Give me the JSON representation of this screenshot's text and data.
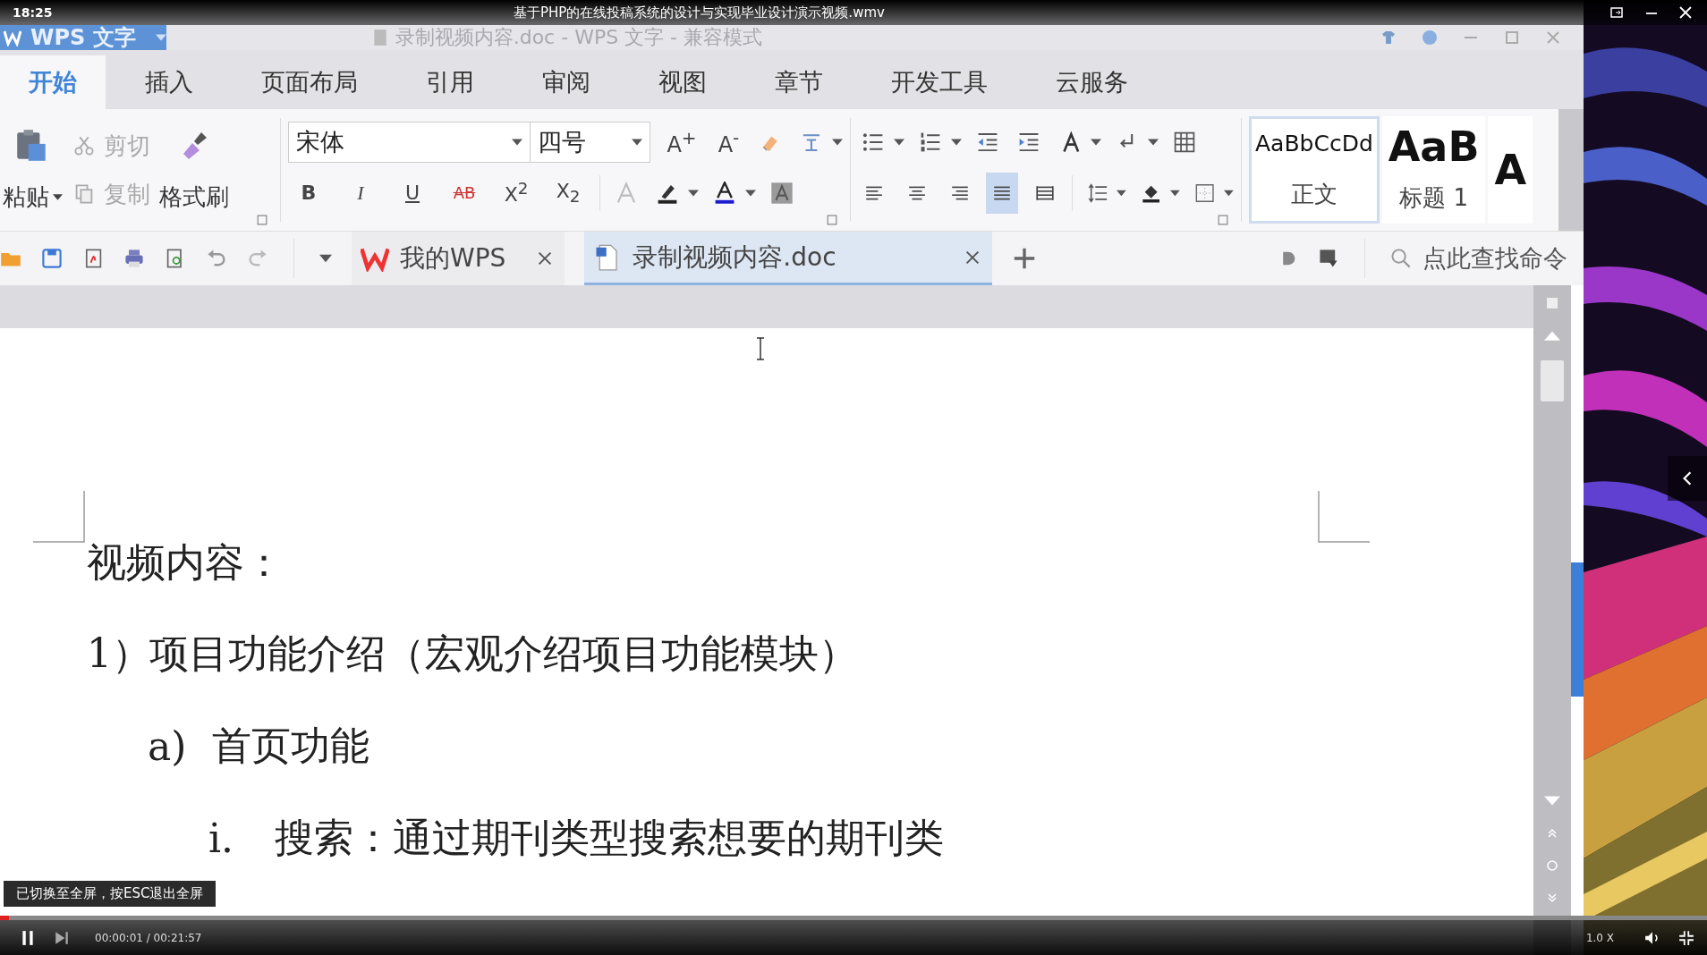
{
  "player": {
    "clock": "18:25",
    "title": "基于PHP的在线投稿系统的设计与实现毕业设计演示视频.wmv",
    "playing": true,
    "progress": {
      "level": 0.005
    },
    "time": "00:00:01 / 00:21:57",
    "speed": "1.0 X",
    "toast": "已切换至全屏，按ESC退出全屏"
  },
  "wps": {
    "app_button": "WPS 文字",
    "window_title": "录制视频内容.doc - WPS 文字 - 兼容模式",
    "tabs": [
      {
        "label": "开始",
        "selected": true
      },
      {
        "label": "插入",
        "selected": false
      },
      {
        "label": "页面布局",
        "selected": false
      },
      {
        "label": "引用",
        "selected": false
      },
      {
        "label": "审阅",
        "selected": false
      },
      {
        "label": "视图",
        "selected": false
      },
      {
        "label": "章节",
        "selected": false
      },
      {
        "label": "开发工具",
        "selected": false
      },
      {
        "label": "云服务",
        "selected": false
      }
    ],
    "clipboard": {
      "paste": "粘贴",
      "cut": "剪切",
      "copy": "复制",
      "format_painter": "格式刷"
    },
    "font": {
      "value": "宋体"
    },
    "font_size": {
      "value": "四号"
    },
    "size_buttons": [
      "A$^{+}$",
      "A$^{-}$"
    ],
    "format_buttons": [
      "B",
      "I",
      "U",
      "AB",
      "X$^{2}$",
      "X$_{2}$"
    ],
    "alignments": [
      {
        "kind": "left",
        "selected": false
      },
      {
        "kind": "center",
        "selected": false
      },
      {
        "kind": "right",
        "selected": false
      },
      {
        "kind": "justify",
        "selected": true
      },
      {
        "kind": "distributed",
        "selected": false
      }
    ],
    "styles": [
      {
        "preview": "AaBbCcDd",
        "label": "正文",
        "kind": "normal",
        "selected": true
      },
      {
        "preview": "AaB",
        "label": "标题 1",
        "kind": "heading",
        "selected": false
      },
      {
        "preview": "A",
        "kind": "heading",
        "selected": false
      }
    ],
    "doc_tabs": [
      {
        "label": "我的WPS",
        "kind": "home",
        "selected": false
      },
      {
        "label": "录制视频内容.doc",
        "kind": "document",
        "selected": true
      }
    ],
    "command_search": {
      "placeholder": "点此查找命令"
    }
  },
  "document": {
    "heading": "视频内容：",
    "items": [
      {
        "marker": "1）",
        "text": "项目功能介绍（宏观介绍项目功能模块）",
        "children": [
          {
            "marker": "a)",
            "text": "首页功能",
            "children": [
              {
                "marker": "i.",
                "text": "搜索：通过期刊类型搜索想要的期刊类"
              }
            ]
          }
        ]
      }
    ]
  }
}
